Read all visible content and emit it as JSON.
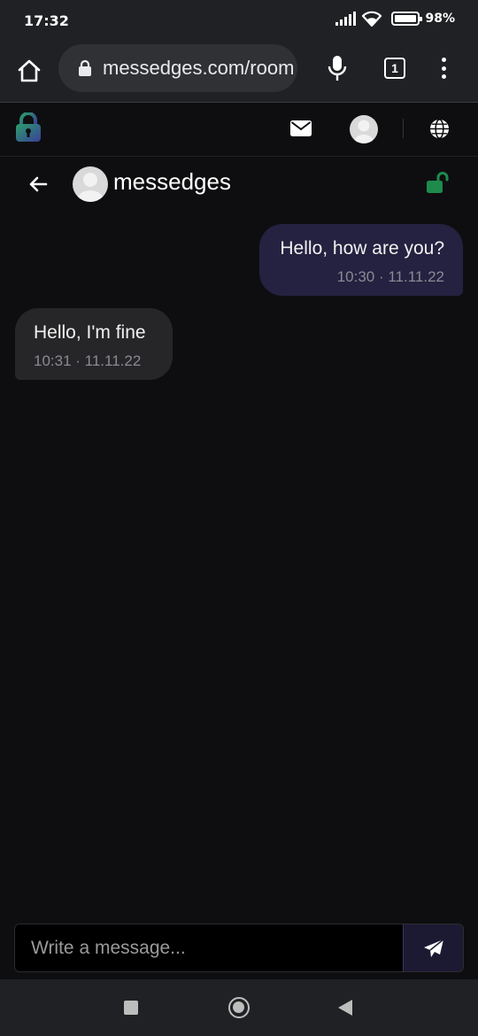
{
  "status_bar": {
    "time": "17:32",
    "battery": "98%"
  },
  "browser": {
    "url": "messedges.com/room",
    "tab_count": "1"
  },
  "app": {
    "contact_name": "messedges"
  },
  "messages": [
    {
      "direction": "outgoing",
      "text": "Hello, how are you?",
      "time": "10:30 · 11.11.22"
    },
    {
      "direction": "incoming",
      "text": "Hello, I'm fine",
      "time": "10:31 · 11.11.22"
    }
  ],
  "composer": {
    "placeholder": "Write a message..."
  },
  "colors": {
    "lock_green": "#1e8a4c",
    "outgoing_bubble": "#252140",
    "incoming_bubble": "#262628"
  }
}
